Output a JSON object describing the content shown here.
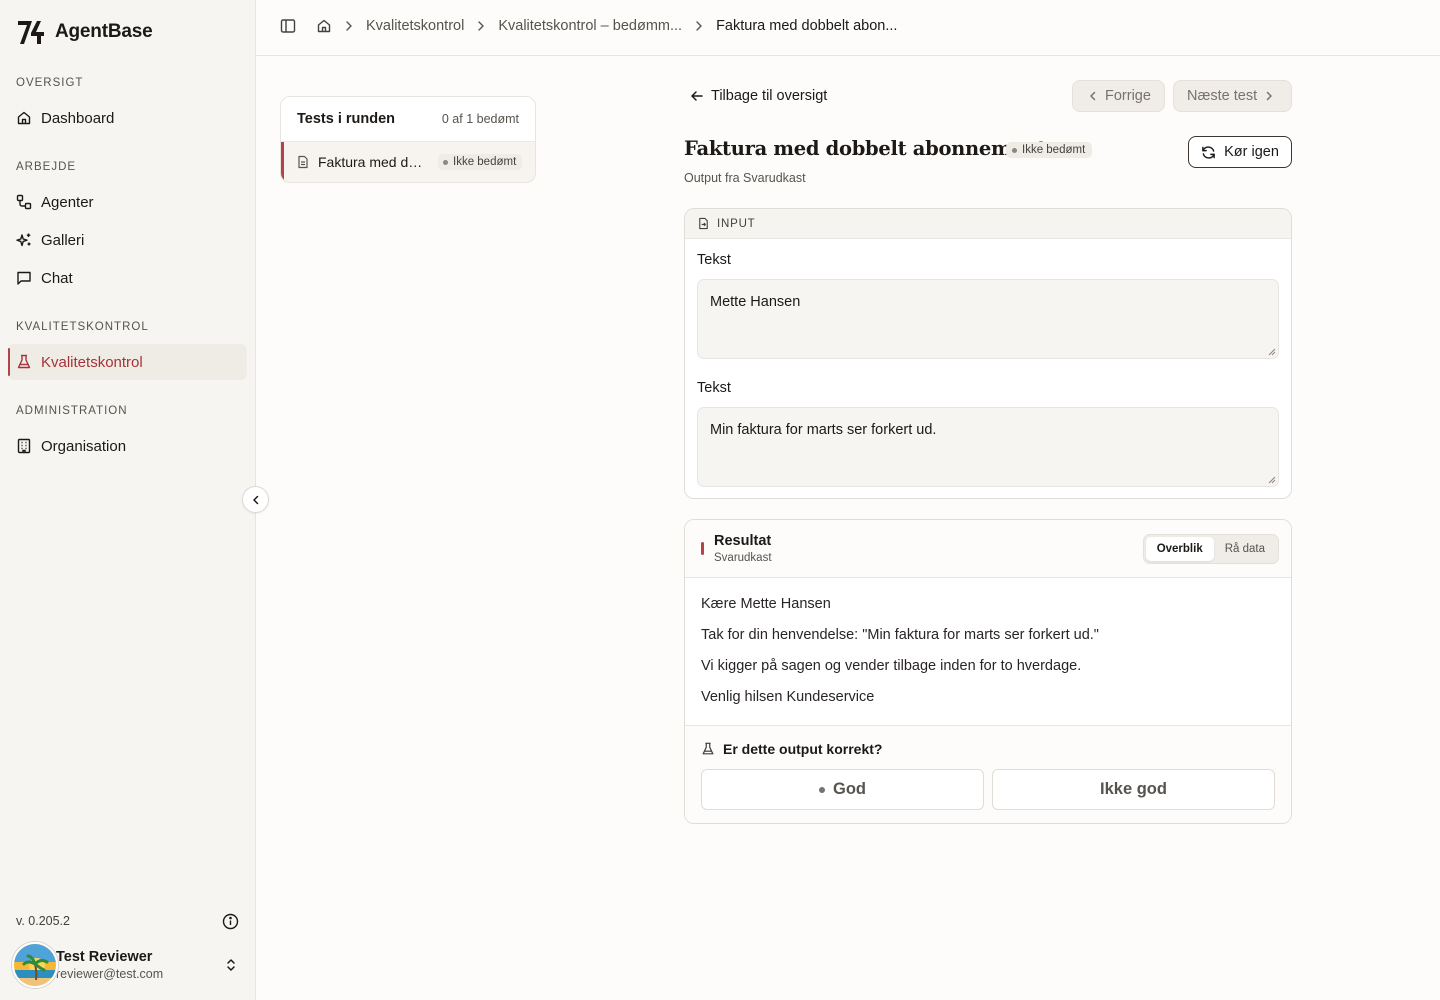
{
  "sidebar": {
    "brand": "AgentBase",
    "sections": [
      {
        "label": "OVERSIGT",
        "items": [
          {
            "label": "Dashboard",
            "icon": "home-icon"
          }
        ]
      },
      {
        "label": "ARBEJDE",
        "items": [
          {
            "label": "Agenter",
            "icon": "workflow-icon"
          },
          {
            "label": "Galleri",
            "icon": "sparkles-icon"
          },
          {
            "label": "Chat",
            "icon": "chat-icon"
          }
        ]
      },
      {
        "label": "KVALITETSKONTROL",
        "items": [
          {
            "label": "Kvalitetskontrol",
            "icon": "flask-icon",
            "active": true
          }
        ]
      },
      {
        "label": "ADMINISTRATION",
        "items": [
          {
            "label": "Organisation",
            "icon": "building-icon"
          }
        ]
      }
    ],
    "version": "v. 0.205.2",
    "user": {
      "name": "Test Reviewer",
      "email": "reviewer@test.com"
    }
  },
  "breadcrumb": {
    "items": [
      "Kvalitetskontrol",
      "Kvalitetskontrol – bedømm..."
    ],
    "current": "Faktura med dobbelt abon..."
  },
  "tests": {
    "title": "Tests i runden",
    "count": "0 af 1 bedømt",
    "rows": [
      {
        "name": "Faktura med dobbelt abonnement",
        "status": "Ikke bedømt"
      }
    ]
  },
  "main": {
    "back": "Tilbage til oversigt",
    "prev": "Forrige",
    "next": "Næste test",
    "title": "Faktura med dobbelt abonnement",
    "status": "Ikke bedømt",
    "subtitle": "Output fra Svarudkast",
    "run_again": "Kør igen"
  },
  "input": {
    "header": "INPUT",
    "fields": [
      {
        "label": "Tekst",
        "value": "Mette Hansen"
      },
      {
        "label": "Tekst",
        "value": "Min faktura for marts ser forkert ud."
      }
    ]
  },
  "result": {
    "title": "Resultat",
    "subtitle": "Svarudkast",
    "tabs": [
      "Overblik",
      "Rå data"
    ],
    "lines": [
      "Kære Mette Hansen",
      "Tak for din henvendelse: \"Min faktura for marts ser forkert ud.\"",
      "Vi kigger på sagen og vender tilbage inden for to hverdage.",
      "Venlig hilsen Kundeservice"
    ],
    "question": "Er dette output korrekt?",
    "good": "God",
    "bad": "Ikke god"
  },
  "colors": {
    "accent": "#b4424a",
    "sidebar_bg": "#f7f5f1",
    "page_bg": "#fdfcfa"
  }
}
